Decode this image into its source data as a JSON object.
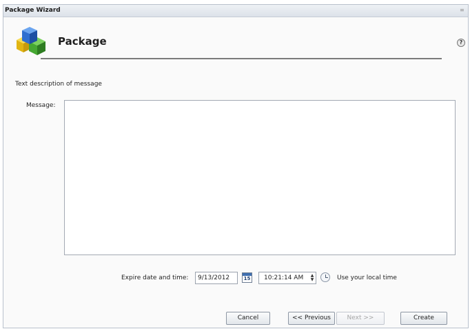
{
  "window": {
    "title": "Package Wizard",
    "grip_icon": "resize-grip-icon"
  },
  "header": {
    "title": "Package",
    "icon": "package-blocks-icon",
    "help_icon": "help-icon",
    "help_glyph": "?"
  },
  "body": {
    "description": "Text description of message",
    "message_label": "Message:",
    "message_value": ""
  },
  "expire": {
    "label": "Expire date and time:",
    "date_value": "9/13/2012",
    "calendar_day": "15",
    "time_value": "10:21:14 AM",
    "local_time_label": "Use your local time"
  },
  "buttons": {
    "cancel": "Cancel",
    "previous": "<< Previous",
    "next": "Next >>",
    "create": "Create"
  },
  "colors": {
    "cube_blue": "#2f6fd0",
    "cube_green": "#46a832",
    "cube_yellow": "#e8c21c"
  }
}
